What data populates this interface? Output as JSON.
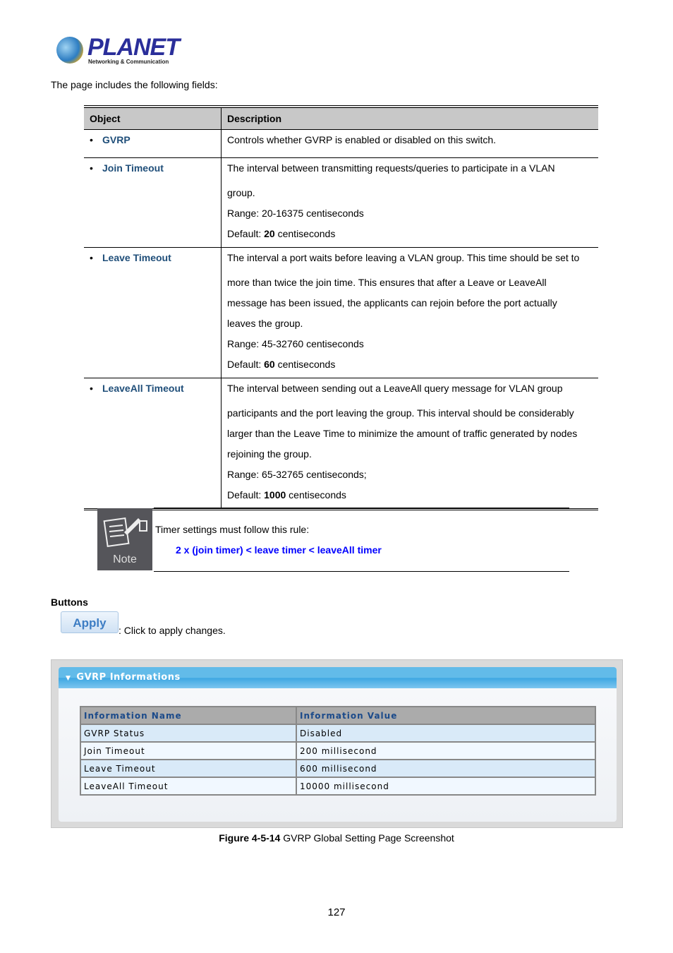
{
  "logo": {
    "brand": "PLANET",
    "tagline": "Networking & Communication"
  },
  "intro": "The page includes the following fields:",
  "fields_table": {
    "headers": [
      "Object",
      "Description"
    ],
    "rows": [
      {
        "object": "GVRP",
        "lines": [
          "Controls whether GVRP is enabled or disabled on this switch."
        ]
      },
      {
        "object": "Join Timeout",
        "lines": [
          "The interval between transmitting requests/queries to participate in a VLAN",
          "group.",
          "Range: 20-16375 centiseconds"
        ],
        "default": {
          "prefix": "Default: ",
          "value": "20",
          "suffix": " centiseconds"
        }
      },
      {
        "object": "Leave Timeout",
        "lines": [
          "The interval a port waits before leaving a VLAN group. This time should be set to",
          "more than twice the join time. This ensures that after a Leave or LeaveAll",
          "message has been issued, the applicants can rejoin before the port actually",
          "leaves the group.",
          "Range: 45-32760 centiseconds"
        ],
        "default": {
          "prefix": "Default: ",
          "value": "60",
          "suffix": " centiseconds"
        }
      },
      {
        "object": "LeaveAll Timeout",
        "lines": [
          "The interval between sending out a LeaveAll query message for VLAN group",
          "participants and the port leaving the group. This interval should be considerably",
          "larger than the Leave Time to minimize the amount of traffic generated by nodes",
          "rejoining the group.",
          "Range: 65-32765 centiseconds;"
        ],
        "default": {
          "prefix": "Default: ",
          "value": "1000",
          "suffix": " centiseconds"
        }
      }
    ]
  },
  "note": {
    "icon_label": "Note",
    "text": "Timer settings must follow this rule:",
    "rule": "2 x (join timer) < leave timer < leaveAll timer"
  },
  "buttons": {
    "heading": "Buttons",
    "apply_label": "Apply",
    "apply_desc": ": Click to apply changes."
  },
  "screenshot": {
    "panel_title": "GVRP Informations",
    "headers": [
      "Information Name",
      "Information Value"
    ],
    "rows": [
      [
        "GVRP Status",
        "Disabled"
      ],
      [
        "Join Timeout",
        "200 millisecond"
      ],
      [
        "Leave Timeout",
        "600 millisecond"
      ],
      [
        "LeaveAll Timeout",
        "10000 millisecond"
      ]
    ]
  },
  "caption": {
    "label": "Figure 4-5-14",
    "text": " GVRP Global Setting Page Screenshot"
  },
  "page_number": "127",
  "colors": {
    "object_name": "#1f4e79",
    "rule": "#0000ff",
    "panel_header": "#3ea7e2"
  }
}
